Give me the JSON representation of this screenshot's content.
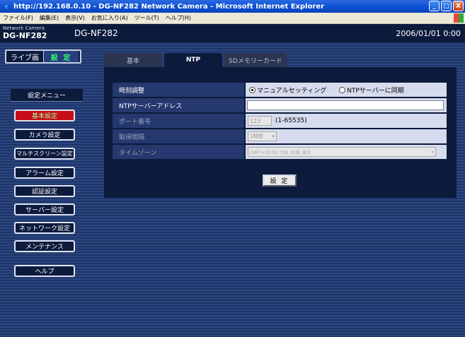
{
  "window": {
    "title": "http://192.168.0.10 - DG-NF282 Network Camera - Microsoft Internet Explorer",
    "buttons": {
      "minimize": "_",
      "maximize": "□",
      "close": "X"
    }
  },
  "menubar": {
    "items": [
      "ファイル(F)",
      "編集(E)",
      "表示(V)",
      "お気に入り(A)",
      "ツール(T)",
      "ヘルプ(H)"
    ]
  },
  "header": {
    "brand_small": "Network Camera",
    "brand_model": "DG-NF282",
    "page_model": "DG-NF282",
    "datetime": "2006/01/01 0:00"
  },
  "leftpanel": {
    "live": "ライブ画",
    "settings": "設 定",
    "menu_title": "設定メニュー",
    "nav": [
      {
        "label": "基本設定",
        "active": true
      },
      {
        "label": "カメラ設定"
      },
      {
        "label": "マルチスクリーン設定"
      },
      {
        "label": "アラーム設定"
      },
      {
        "label": "認証設定"
      },
      {
        "label": "サーバー設定"
      },
      {
        "label": "ネットワーク設定"
      },
      {
        "label": "メンテナンス"
      },
      {
        "label": "ヘルプ"
      }
    ]
  },
  "tabs": [
    {
      "label": "基本"
    },
    {
      "label": "NTP",
      "active": true
    },
    {
      "label": "SDメモリーカード"
    }
  ],
  "form": {
    "time_adjust": {
      "label": "時刻調整",
      "option_manual": "マニュアルセッティング",
      "option_ntp": "NTPサーバーに同期",
      "selected": "manual"
    },
    "ntp_server": {
      "label": "NTPサーバーアドレス",
      "value": ""
    },
    "port": {
      "label": "ポート番号",
      "value": "123",
      "range": "(1-65535)"
    },
    "interval": {
      "label": "取得間隔",
      "value": "1時間"
    },
    "timezone": {
      "label": "タイムゾーン",
      "value": "(GMT+09:00) 大阪, 札幌, 東京"
    },
    "submit": "設 定"
  },
  "colors": {
    "accent_active": "#c70d19",
    "settings_green": "#2eff6a",
    "panel_dark": "#0c1a3c"
  }
}
